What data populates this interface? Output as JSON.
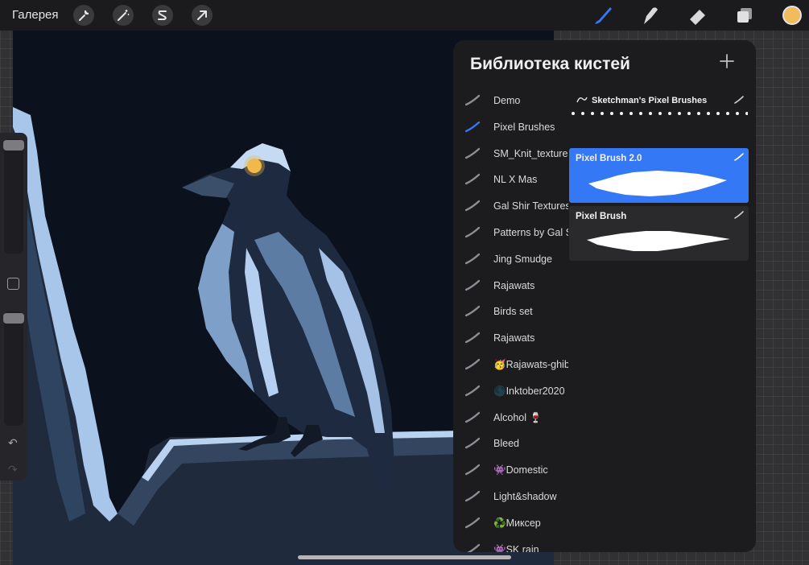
{
  "topbar": {
    "gallery_label": "Галерея",
    "actions": [
      "wrench-icon",
      "magic-wand-icon",
      "selection-icon",
      "transform-arrow-icon"
    ],
    "tools": [
      "brush-icon",
      "smudge-icon",
      "eraser-icon",
      "layers-icon"
    ],
    "active_tool": "brush-icon",
    "color": "#f1bc5b"
  },
  "sidebar": {
    "undo_icon": "↶",
    "redo_icon": "↷"
  },
  "library": {
    "title": "Библиотека кистей",
    "add_icon": "plus-icon",
    "sets": [
      {
        "label": "Demo"
      },
      {
        "label": "Pixel Brushes"
      },
      {
        "label": "SM_Knit_textures"
      },
      {
        "label": "NL X Mas"
      },
      {
        "label": "Gal Shir Textures"
      },
      {
        "label": "Patterns by Gal Shir"
      },
      {
        "label": "Jing Smudge"
      },
      {
        "label": "Rajawats"
      },
      {
        "label": "Birds set"
      },
      {
        "label": "Rajawats"
      },
      {
        "label": "🥳Rajawats-ghibli"
      },
      {
        "label": "🌑Inktober2020"
      },
      {
        "label": "Alcohol 🍷"
      },
      {
        "label": "Bleed"
      },
      {
        "label": "👾Domestic"
      },
      {
        "label": "Light&shadow"
      },
      {
        "label": "♻️Миксер"
      },
      {
        "label": "👾SK rain"
      }
    ],
    "selected_set": "Pixel Brushes",
    "header_brush": "Sketchman's Pixel Brushes",
    "brushes": [
      {
        "name": "Pixel Brush  2.0",
        "selected": true
      },
      {
        "name": "Pixel Brush",
        "selected": false
      }
    ]
  },
  "colors": {
    "accent": "#3478f6",
    "panel": "#1c1c1e",
    "canvas": "#0c111e"
  }
}
